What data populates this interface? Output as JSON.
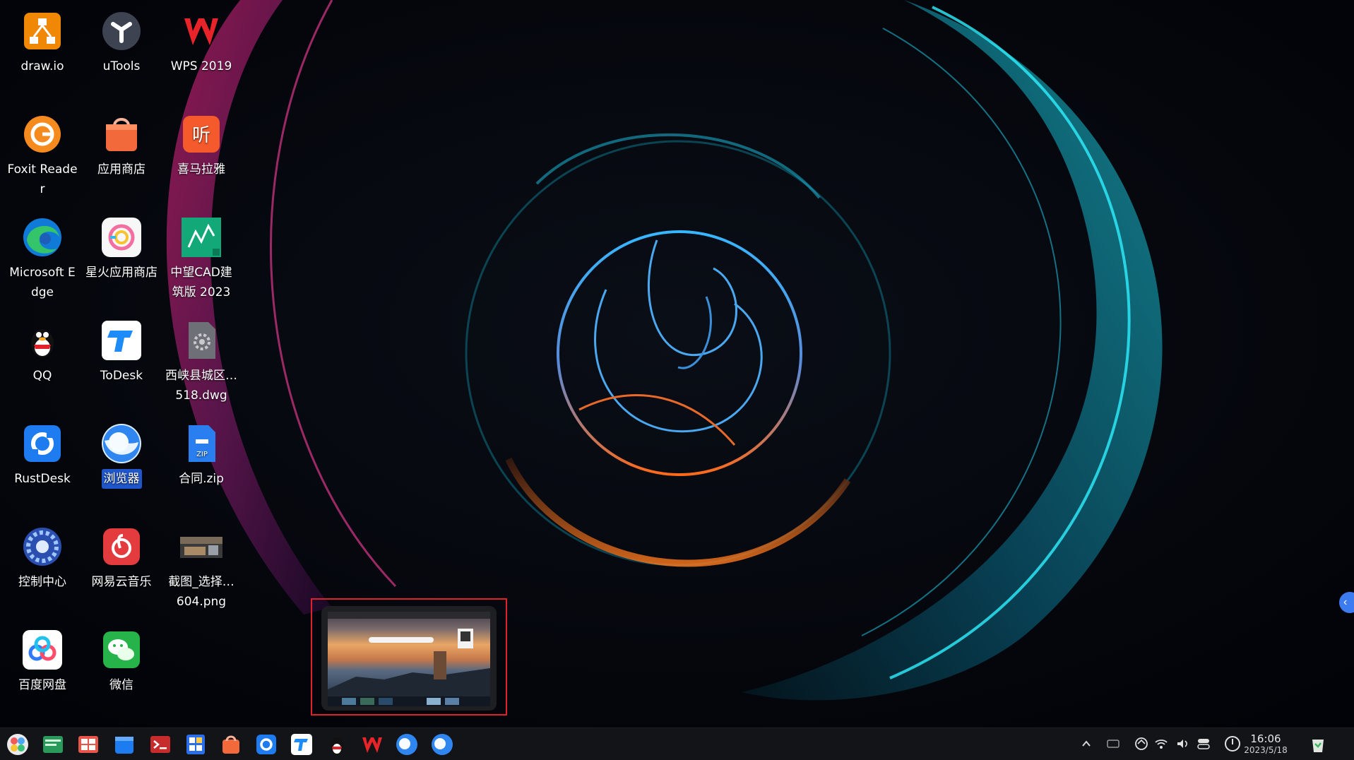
{
  "desktop": {
    "icons": [
      {
        "label": "draw.io",
        "icon": "drawio-icon"
      },
      {
        "label": "uTools",
        "icon": "utools-icon"
      },
      {
        "label": "WPS 2019",
        "icon": "wps-icon"
      },
      {
        "label": "Foxit Reader",
        "icon": "foxit-icon"
      },
      {
        "label": "应用商店",
        "icon": "app-store-icon"
      },
      {
        "label": "喜马拉雅",
        "icon": "ximalaya-icon"
      },
      {
        "label": "Microsoft Edge",
        "icon": "edge-icon"
      },
      {
        "label": "星火应用商店",
        "icon": "spark-store-icon"
      },
      {
        "label": "中望CAD建筑版 2023",
        "icon": "zwcad-icon"
      },
      {
        "label": "QQ",
        "icon": "qq-icon"
      },
      {
        "label": "ToDesk",
        "icon": "todesk-icon"
      },
      {
        "label": "西峡县城区…518.dwg",
        "icon": "dwg-file-icon"
      },
      {
        "label": "RustDesk",
        "icon": "rustdesk-icon"
      },
      {
        "label": "浏览器",
        "icon": "browser-icon",
        "selected": true
      },
      {
        "label": "合同.zip",
        "icon": "zip-file-icon"
      },
      {
        "label": "控制中心",
        "icon": "control-center-icon"
      },
      {
        "label": "网易云音乐",
        "icon": "netease-music-icon"
      },
      {
        "label": "截图_选择…604.png",
        "icon": "png-file-icon"
      },
      {
        "label": "百度网盘",
        "icon": "baidu-netdisk-icon"
      },
      {
        "label": "微信",
        "icon": "wechat-icon"
      }
    ]
  },
  "taskbar": {
    "apps": [
      "launcher-icon",
      "terminal-green-icon",
      "multitask-view-icon",
      "file-manager-icon",
      "terminal-icon",
      "calculator-icon",
      "app-store-icon",
      "rustdesk-icon",
      "todesk-icon",
      "qq-icon",
      "wps-icon",
      "browser-icon",
      "browser-icon-2"
    ],
    "tray": [
      "chevron-up-icon",
      "keyboard-icon",
      "network-icon",
      "wifi-icon",
      "volume-icon",
      "toggle-icon",
      "power-icon"
    ],
    "clock": {
      "time": "16:06",
      "date": "2023/5/18"
    },
    "trash": "trash-icon"
  },
  "colors": {
    "selection": "#1f56c9",
    "preview_border": "#e0202a",
    "taskbar": "#121417"
  }
}
